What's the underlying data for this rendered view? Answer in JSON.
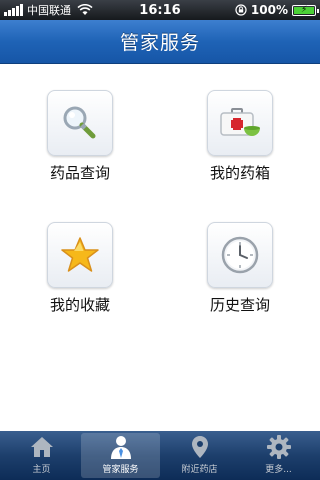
{
  "status_bar": {
    "carrier": "中国联通",
    "time": "16:16",
    "battery": "100%",
    "battery_level": 1.0
  },
  "nav": {
    "title": "管家服务"
  },
  "grid": {
    "items": [
      {
        "label": "药品查询",
        "icon": "magnifier-icon"
      },
      {
        "label": "我的药箱",
        "icon": "medicine-box-icon"
      },
      {
        "label": "我的收藏",
        "icon": "star-icon"
      },
      {
        "label": "历史查询",
        "icon": "clock-icon"
      }
    ]
  },
  "tab_bar": {
    "tabs": [
      {
        "label": "主页",
        "icon": "home-icon",
        "active": false
      },
      {
        "label": "管家服务",
        "icon": "butler-icon",
        "active": true
      },
      {
        "label": "附近药店",
        "icon": "location-pin-icon",
        "active": false
      },
      {
        "label": "更多...",
        "icon": "gear-icon",
        "active": false
      }
    ]
  },
  "colors": {
    "nav_blue": "#1f63b6",
    "tab_bar_blue": "#1d3f6c"
  }
}
